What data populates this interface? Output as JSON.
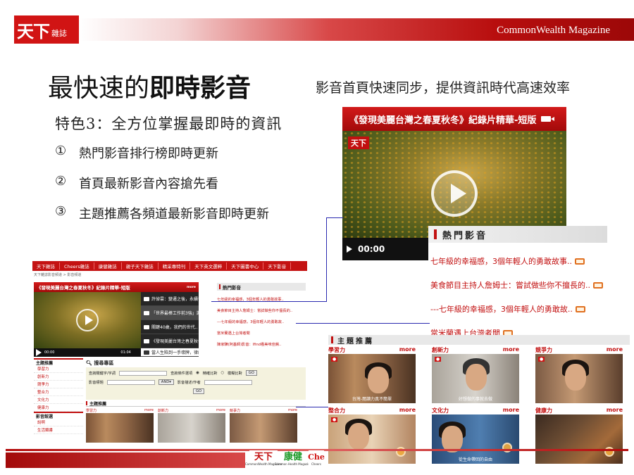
{
  "header": {
    "logo_main": "天下",
    "logo_sub": "雜誌",
    "magazine_name": "CommonWealth Magazine"
  },
  "headline": {
    "lead": "最快速的",
    "strong": "即時影音",
    "tagline": "影音首頁快速同步，提供資訊時代高速效率"
  },
  "features": {
    "title": "特色3：全方位掌握最即時的資訊",
    "items": [
      {
        "num": "①",
        "text": "熱門影音排行榜即時更新"
      },
      {
        "num": "②",
        "text": "首頁最新影音內容搶先看"
      },
      {
        "num": "③",
        "text": "主題推薦各頻道最新影音即時更新"
      }
    ]
  },
  "big_video": {
    "title": "《發現美麗台灣之春夏秋冬》紀錄片精華-短版",
    "time": "00:00",
    "watermark": "天下"
  },
  "hot_panel": {
    "heading": "熱門影音",
    "items": [
      "七年級的幸福感，3個年輕人的勇敢故事..",
      "美食節目主持人詹姆士：嘗試做些你不擅長的..",
      "---七年級的幸福感，3個年輕人的勇敢故..",
      "當米蘭遇上台灣者聞"
    ]
  },
  "site": {
    "nav": [
      "天下雜誌",
      "Cheers雜誌",
      "康健雜誌",
      "親子天下雜誌",
      "精采專特刊",
      "天下英文選粹",
      "天下圖書中心",
      "天下影音"
    ],
    "breadcrumb": "天下雜誌影音頻道 > 影音頻道",
    "video_title": "《發現美麗台灣之春夏秋冬》紀錄片精華-短版",
    "video_more": "more",
    "video_time": "00:00",
    "video_duration": "01:04",
    "list": [
      "許倬雲：變遷之後，永續有份..",
      "「世界最棒工作前3強」謝昕..",
      "關鍵40歲，我們的世代..",
      "《發現美麗台灣之春夏秋冬》..",
      "當人生陷到一手壞牌，律師遇.."
    ],
    "hot_heading": "熱門影音",
    "hot_items": [
      "七年級的幸福感，3個年輕人的勇敢故事..",
      "美食節目主持人詹姆士：嘗試做些你不擅長的..",
      "---七年級的幸福感，3個年輕人的勇敢故..",
      "當米蘭遇上台灣者聞",
      "陳家驊(阿基師)影音：Ifind看美味佳餚.."
    ],
    "side_heading": "主題推薦",
    "side_items": [
      "學習力",
      "創新力",
      "競爭力",
      "整合力",
      "文化力",
      "健康力"
    ],
    "side_heading2": "影音館選",
    "side_items2": [
      "說啊",
      "生活類書"
    ],
    "search_title": "搜尋專區",
    "search_label1": "查詢關鍵字/字詞",
    "search_label2": "查詢條件選項",
    "search_opt1": "精確比對",
    "search_opt2": "模糊比對",
    "search_go": "GO",
    "search_label3": "影音標題",
    "search_select": "AND",
    "search_label4": "影音描述/作者",
    "theme_heading": "主題推薦",
    "theme_caps": [
      "學習力",
      "創新力",
      "競爭力"
    ],
    "theme_more": "more"
  },
  "theme": {
    "heading": "主題推薦",
    "more": "more",
    "cells": [
      {
        "label": "學習力",
        "caption": "台灣-閱讀力真不簡單"
      },
      {
        "label": "創新力",
        "caption": "好想做的事就去做"
      },
      {
        "label": "競爭力",
        "caption": ""
      },
      {
        "label": "整合力",
        "caption": ""
      },
      {
        "label": "文化力",
        "caption": "從生命帶回的自由"
      },
      {
        "label": "健康力",
        "caption": ""
      }
    ]
  },
  "footer": {
    "logo1_main": "天下",
    "logo1_sub": "CommonWealth Magazine",
    "logo2_main": "康健",
    "logo2_sub": "Common Health Magazine",
    "logo3_main": "Che",
    "logo3_sub": "Cheers"
  },
  "colors": {
    "brand_red": "#c21010",
    "connector_blue": "#2a2ab0"
  }
}
